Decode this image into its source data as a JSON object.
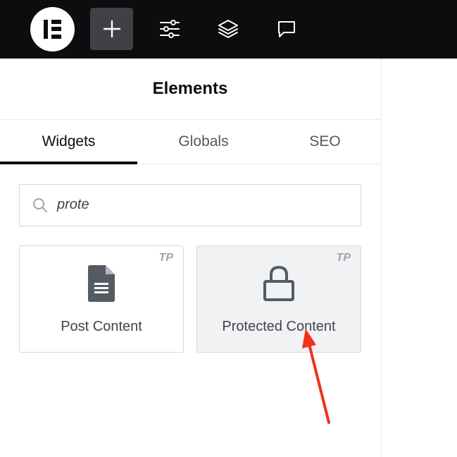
{
  "topbar": {
    "logo_icon": "elementor-logo-icon",
    "buttons": [
      {
        "name": "add-element-button",
        "icon": "plus-icon",
        "active": true
      },
      {
        "name": "site-settings-button",
        "icon": "sliders-icon",
        "active": false
      },
      {
        "name": "structure-button",
        "icon": "layers-icon",
        "active": false
      },
      {
        "name": "notes-button",
        "icon": "chat-bubble-icon",
        "active": false
      }
    ]
  },
  "panel": {
    "title": "Elements",
    "tabs": [
      {
        "label": "Widgets",
        "active": true
      },
      {
        "label": "Globals",
        "active": false
      },
      {
        "label": "SEO",
        "active": false
      }
    ],
    "search": {
      "value": "prote",
      "icon": "search-icon"
    },
    "widgets": [
      {
        "label": "Post Content",
        "badge": "TP",
        "icon": "document-icon"
      },
      {
        "label": "Protected Content",
        "badge": "TP",
        "icon": "lock-icon"
      }
    ]
  },
  "colors": {
    "topbar_bg": "#0c0d0e",
    "active_button_bg": "#3f4144",
    "annotation_arrow": "#f0321e"
  }
}
